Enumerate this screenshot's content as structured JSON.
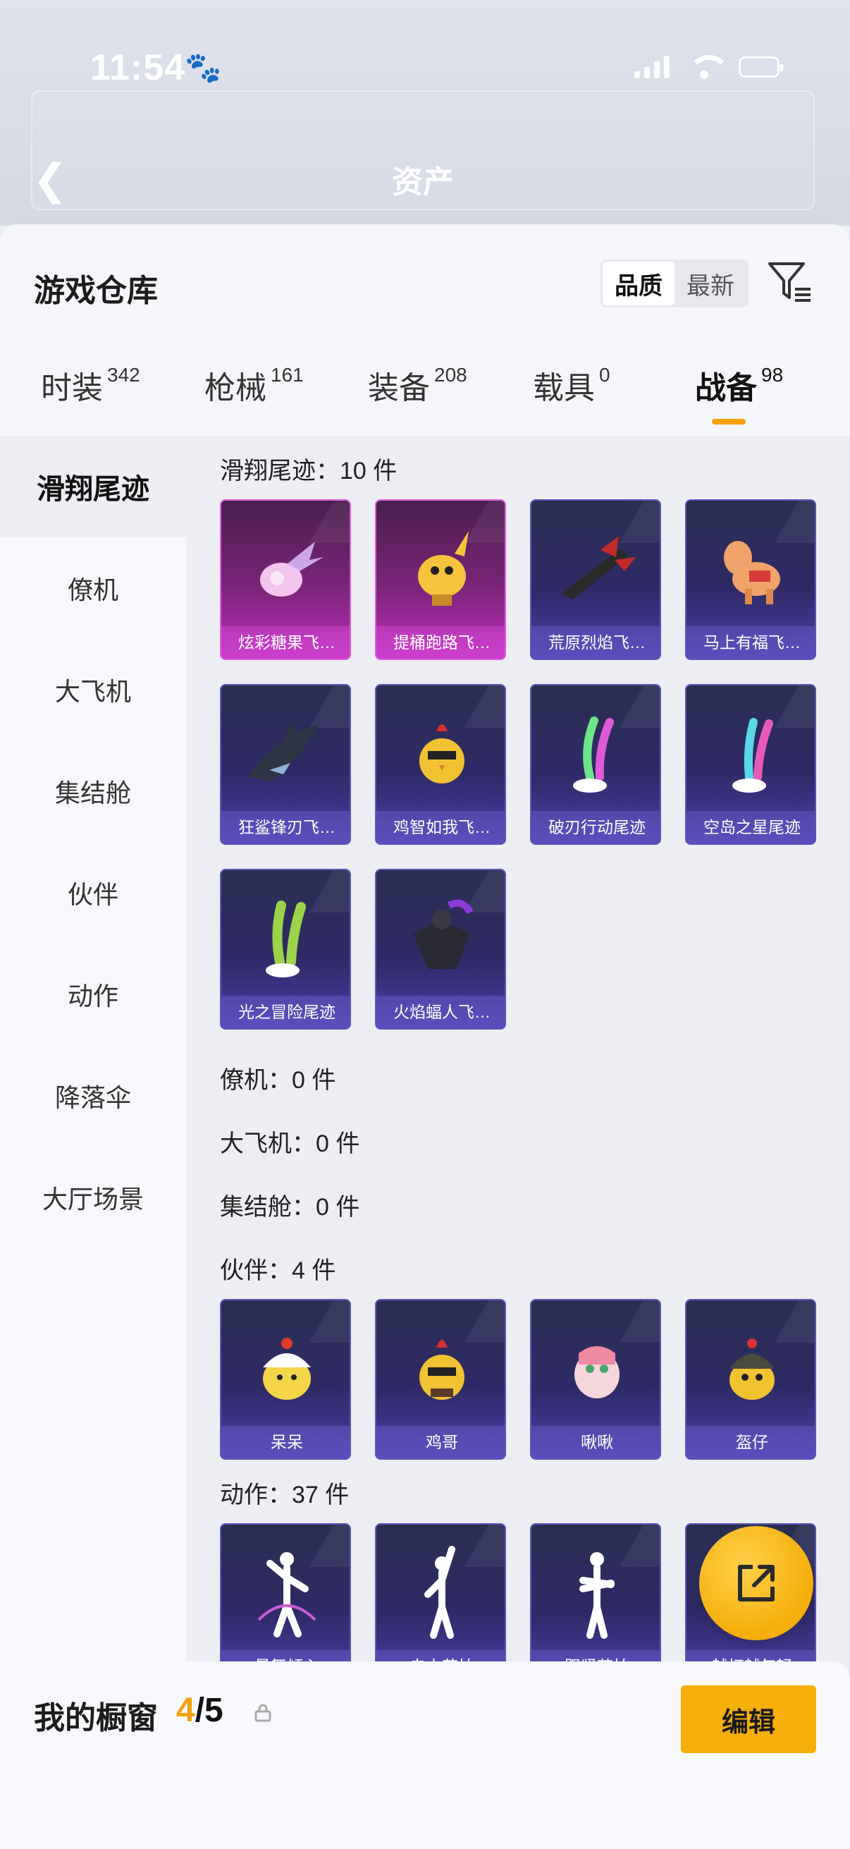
{
  "status_bar": {
    "time": "11:54"
  },
  "background": {
    "title": "资产"
  },
  "sheet": {
    "title": "游戏仓库",
    "sort": {
      "options": [
        "品质",
        "最新"
      ],
      "selected": "品质"
    }
  },
  "tabs": [
    {
      "label": "时装",
      "count": "342"
    },
    {
      "label": "枪械",
      "count": "161"
    },
    {
      "label": "装备",
      "count": "208"
    },
    {
      "label": "载具",
      "count": "0"
    },
    {
      "label": "战备",
      "count": "98",
      "active": true
    }
  ],
  "sidebar": {
    "items": [
      "滑翔尾迹",
      "僚机",
      "大飞机",
      "集结舱",
      "伙伴",
      "动作",
      "降落伞",
      "大厅场景"
    ],
    "active": "滑翔尾迹"
  },
  "sections": {
    "glide": {
      "label": "滑翔尾迹：10 件",
      "items": [
        "炫彩糖果飞…",
        "提桶跑路飞…",
        "荒原烈焰飞…",
        "马上有福飞…",
        "狂鲨锋刃飞…",
        "鸡智如我飞…",
        "破刃行动尾迹",
        "空岛之星尾迹",
        "光之冒险尾迹",
        "火焰蝠人飞…"
      ]
    },
    "wingman": {
      "label": "僚机：0 件"
    },
    "plane": {
      "label": "大飞机：0 件"
    },
    "pod": {
      "label": "集结舱：0 件"
    },
    "partner": {
      "label": "伙伴：4 件",
      "items": [
        "呆呆",
        "鸡哥",
        "啾啾",
        "盔仔"
      ]
    },
    "emote": {
      "label": "动作：37 件",
      "items": [
        "曼舞倾心",
        "自由节拍",
        "跟紧节拍",
        "越打越年轻"
      ]
    }
  },
  "bottom_bar": {
    "label": "我的橱窗",
    "current": "4",
    "total": "/5",
    "edit_label": "编辑"
  },
  "colors": {
    "accent": "#f5ae0a",
    "card_epic": "#4a3fa8",
    "card_legend": "#c02fbe"
  }
}
